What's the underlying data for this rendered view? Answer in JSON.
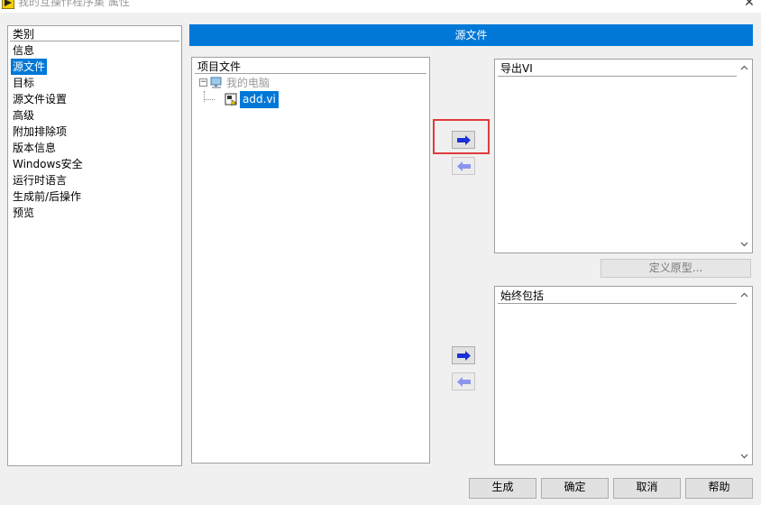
{
  "window": {
    "title": "我的互操作程序集 属性",
    "close_glyph": "✕"
  },
  "category": {
    "header": "类别",
    "items": [
      {
        "label": "信息"
      },
      {
        "label": "源文件",
        "selected": true
      },
      {
        "label": "目标"
      },
      {
        "label": "源文件设置"
      },
      {
        "label": "高级"
      },
      {
        "label": "附加排除项"
      },
      {
        "label": "版本信息"
      },
      {
        "label": "Windows安全"
      },
      {
        "label": "运行时语言"
      },
      {
        "label": "生成前/后操作"
      },
      {
        "label": "预览"
      }
    ]
  },
  "section_header": "源文件",
  "project_files": {
    "header": "项目文件",
    "expand_glyph": "⊟",
    "tree": {
      "root_label": "我的电脑",
      "root_icon": "computer-icon",
      "child_label": "add.vi",
      "child_icon": "vi-file-icon"
    }
  },
  "export_vi": {
    "header": "导出VI"
  },
  "always_include": {
    "header": "始终包括"
  },
  "define_prototype": "定义原型...",
  "buttons": {
    "build": "生成",
    "ok": "确定",
    "cancel": "取消",
    "help": "帮助"
  },
  "colors": {
    "accent": "#0078d7",
    "arrow_active": "#1a2fd6",
    "arrow_disabled": "#8a95ee",
    "highlight": "#e03c3c"
  }
}
